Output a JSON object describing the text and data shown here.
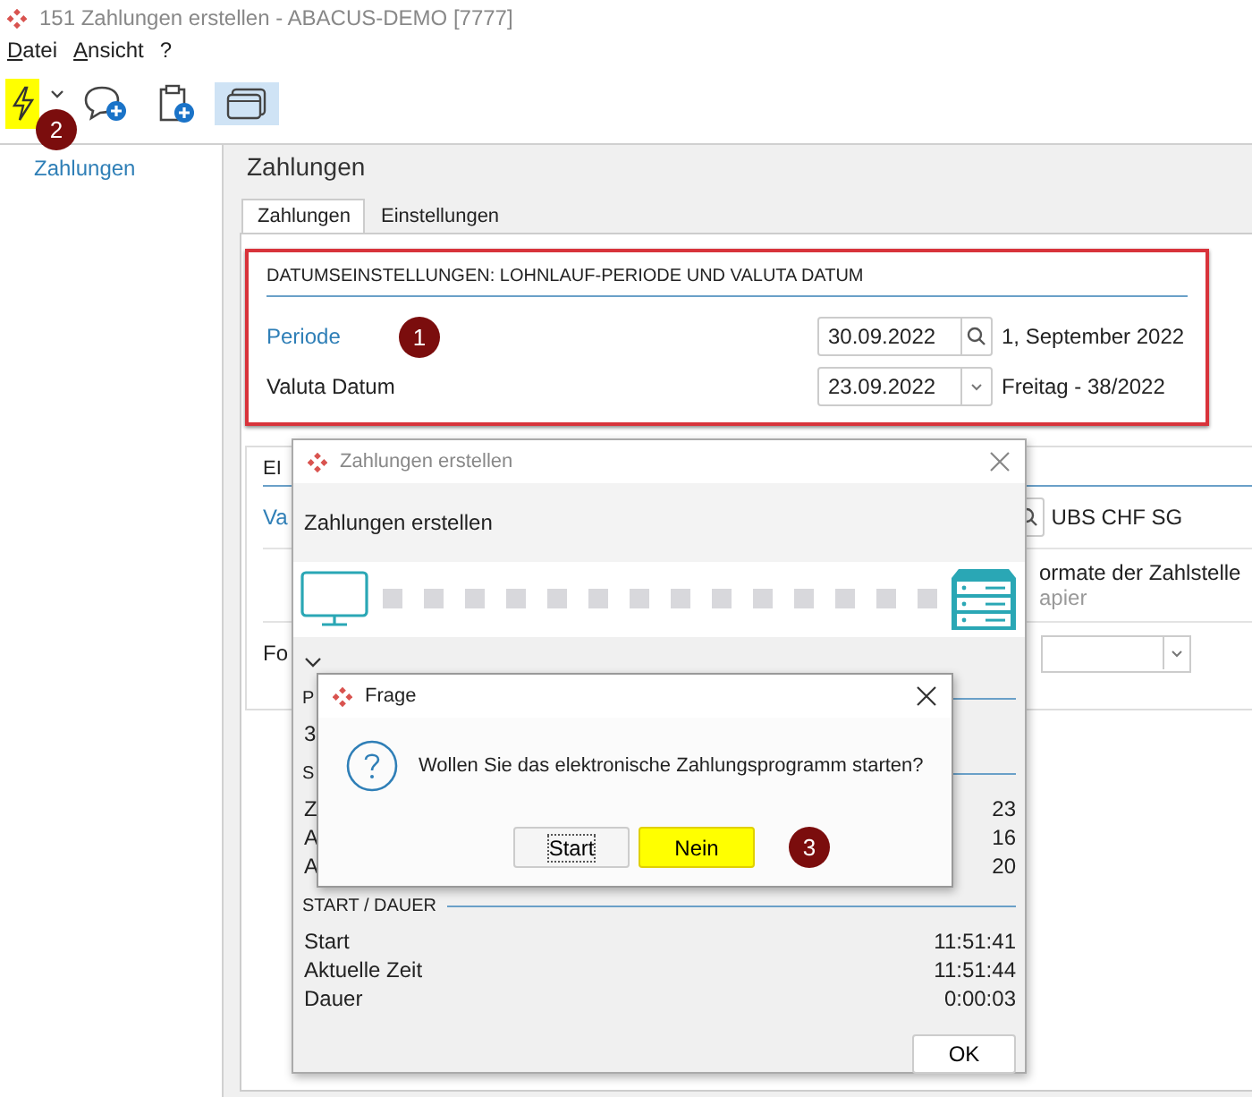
{
  "window": {
    "title": "151 Zahlungen erstellen - ABACUS-DEMO [7777]"
  },
  "menu": [
    {
      "label": "Datei"
    },
    {
      "label": "Ansicht"
    },
    {
      "label": "?"
    }
  ],
  "toolbar": {
    "marker": "2",
    "buttons": [
      {
        "kind": "lightning",
        "highlighted": true,
        "selected": false
      },
      {
        "kind": "dropdown",
        "highlighted": false,
        "selected": false
      },
      {
        "kind": "comment-add",
        "highlighted": false,
        "selected": false
      },
      {
        "kind": "clipboard-add",
        "highlighted": false,
        "selected": false
      },
      {
        "kind": "window",
        "highlighted": false,
        "selected": true
      }
    ]
  },
  "sidebar": {
    "items": [
      {
        "label": "Zahlungen",
        "selected": true
      }
    ]
  },
  "main": {
    "heading": "Zahlungen",
    "tabs": [
      {
        "label": "Zahlungen",
        "selected": true
      },
      {
        "label": "Einstellungen",
        "selected": false
      }
    ],
    "date_section": {
      "heading": "DATUMSEINSTELLUNGEN: LOHNLAUF-PERIODE UND VALUTA DATUM",
      "highlighted": true,
      "marker": "1",
      "fields": [
        {
          "label": "Periode",
          "link": true,
          "kind": "lookup",
          "value": "30.09.2022",
          "info": "1, September 2022"
        },
        {
          "label": "Valuta Datum",
          "link": false,
          "kind": "dropdown",
          "value": "23.09.2022",
          "info": "Freitag - 38/2022"
        }
      ]
    },
    "second_section": {
      "heading": "EI",
      "rows": [
        {
          "kind": "lookup",
          "label": "Va",
          "link": true,
          "value": "UBS CHF SG"
        },
        {
          "kind": "text",
          "value": "ormate der Zahlstelle",
          "note": "apier"
        },
        {
          "kind": "dropdown",
          "label": "Fo",
          "link": false
        }
      ]
    }
  },
  "progress_dialog": {
    "title": "Zahlungen erstellen",
    "heading": "Zahlungen erstellen",
    "sections": [
      {
        "heading": "P",
        "rows": [
          {
            "label": "3"
          }
        ]
      },
      {
        "heading": "S",
        "rows": [
          {
            "label": "Z",
            "value": "23"
          },
          {
            "label": "A",
            "value": "16"
          },
          {
            "label": "A",
            "value": "20"
          }
        ]
      },
      {
        "heading": "START / DAUER",
        "rows": [
          {
            "label": "Start",
            "value": "11:51:41"
          },
          {
            "label": "Aktuelle Zeit",
            "value": "11:51:44"
          },
          {
            "label": "Dauer",
            "value": "0:00:03"
          }
        ]
      }
    ],
    "button": "OK"
  },
  "question_dialog": {
    "title": "Frage",
    "message": "Wollen Sie das elektronische Zahlungsprogramm starten?",
    "marker": "3",
    "buttons": [
      {
        "label": "Start",
        "focused": true,
        "highlighted": false
      },
      {
        "label": "Nein",
        "focused": false,
        "highlighted": true
      }
    ]
  }
}
